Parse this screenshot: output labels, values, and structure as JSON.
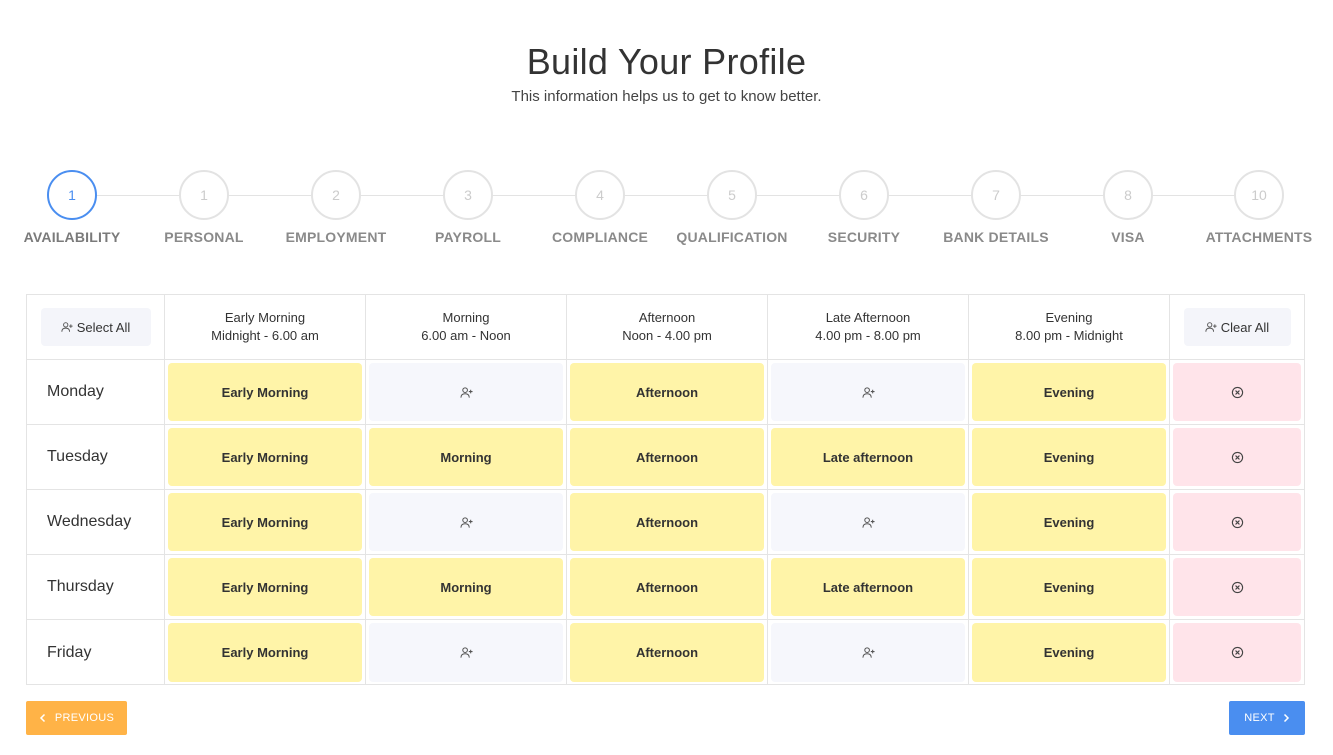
{
  "header": {
    "title": "Build Your Profile",
    "subtitle": "This information helps us to get to know better."
  },
  "steps": [
    {
      "number": "1",
      "label": "AVAILABILITY",
      "active": true
    },
    {
      "number": "1",
      "label": "PERSONAL",
      "active": false
    },
    {
      "number": "2",
      "label": "EMPLOYMENT",
      "active": false
    },
    {
      "number": "3",
      "label": "PAYROLL",
      "active": false
    },
    {
      "number": "4",
      "label": "COMPLIANCE",
      "active": false
    },
    {
      "number": "5",
      "label": "QUALIFICATION",
      "active": false
    },
    {
      "number": "6",
      "label": "SECURITY",
      "active": false
    },
    {
      "number": "7",
      "label": "BANK DETAILS",
      "active": false
    },
    {
      "number": "8",
      "label": "VISA",
      "active": false
    },
    {
      "number": "10",
      "label": "ATTACHMENTS",
      "active": false
    }
  ],
  "table": {
    "select_all_label": "Select All",
    "clear_all_label": "Clear All",
    "columns": [
      {
        "name": "Early Morning",
        "range": "Midnight - 6.00 am"
      },
      {
        "name": "Morning",
        "range": "6.00 am - Noon"
      },
      {
        "name": "Afternoon",
        "range": "Noon - 4.00 pm"
      },
      {
        "name": "Late Afternoon",
        "range": "4.00 pm - 8.00 pm"
      },
      {
        "name": "Evening",
        "range": "8.00 pm - Midnight"
      }
    ],
    "rows": [
      {
        "day": "Monday",
        "slots": [
          "Early Morning",
          "",
          "Afternoon",
          "",
          "Evening"
        ]
      },
      {
        "day": "Tuesday",
        "slots": [
          "Early Morning",
          "Morning",
          "Afternoon",
          "Late afternoon",
          "Evening"
        ]
      },
      {
        "day": "Wednesday",
        "slots": [
          "Early Morning",
          "",
          "Afternoon",
          "",
          "Evening"
        ]
      },
      {
        "day": "Thursday",
        "slots": [
          "Early Morning",
          "Morning",
          "Afternoon",
          "Late afternoon",
          "Evening"
        ]
      },
      {
        "day": "Friday",
        "slots": [
          "Early Morning",
          "",
          "Afternoon",
          "",
          "Evening"
        ]
      }
    ]
  },
  "nav": {
    "previous_label": "PREVIOUS",
    "next_label": "NEXT"
  },
  "icons": {
    "select_all": "user-plus-icon",
    "clear_all": "user-plus-icon",
    "empty_slot": "user-plus-icon",
    "clear_row": "circle-x-icon",
    "previous": "chevron-left-icon",
    "next": "chevron-right-icon"
  },
  "colors": {
    "accent_blue": "#4a8ef0",
    "previous_orange": "#ffb347",
    "selected_slot": "#fff4a8",
    "empty_slot": "#f6f7fc",
    "clear_cell": "#ffe4ea"
  }
}
